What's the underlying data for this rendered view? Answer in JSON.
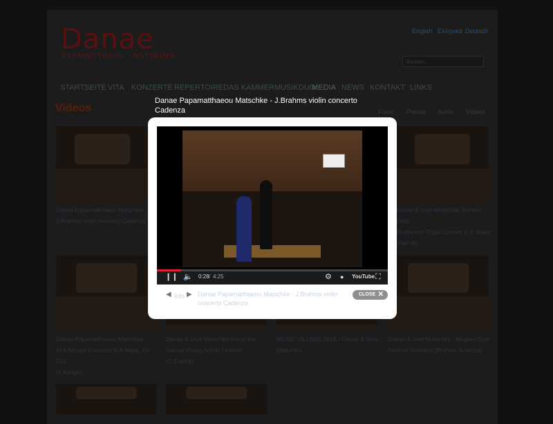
{
  "site": {
    "logo_text": "Danae",
    "logo_subtitle": "PAPAMATTHAOU - MATSCHKE",
    "languages": [
      "English",
      "Ελληνικά",
      "Deutsch"
    ],
    "search_placeholder": "Suchen...",
    "nav": [
      "STARTSEITE",
      "VITA",
      "KONZERTE",
      "REPERTOIRE",
      "DAS KAMMERMUSIKDUO",
      "MEDIA",
      "NEWS",
      "KONTAKT",
      "LINKS"
    ],
    "active_nav": "MEDIA",
    "page_heading": "Videos",
    "subtabs": [
      "Fotos",
      "Presse",
      "Audio",
      "Videos"
    ]
  },
  "videos": [
    {
      "caption_lines": [
        "Danae Papamatthaeou Matschke -",
        "J.Brahms violin concerto Cadenza"
      ]
    },
    {
      "caption_lines": [
        "Danae & Uwe Matschke, Kerstin Feltz -",
        "Beethoven Triple Concert in C Major",
        "(Part III)"
      ]
    },
    {
      "caption_lines": [
        "Danae Papamatthaeou-Matschke -",
        "W.A.Mozart Concerto in A Major, KV 219",
        "(II Adagio)"
      ]
    },
    {
      "caption_lines": [
        "Danae & Uwe Matschke live at the",
        "Samos Young Artists Festival (C.Franck)"
      ]
    },
    {
      "caption_lines": [
        "MUSIC VILLAGE 2010 - Danae & Uwe",
        "Matschke"
      ]
    },
    {
      "caption_lines": [
        "Danae & Uwe Matschke - Megaro Gyzi",
        "Festival Santorini (Brahms Scherzo)"
      ]
    }
  ],
  "modal": {
    "title": "Danae Papamatthaeou Matschke - J.Brahms violin concerto Cadenza",
    "player": {
      "current_time": "0:28",
      "duration": "4:25",
      "progress_fraction": 0.106,
      "youtube_label": "YouTube"
    },
    "footer_info_label": "Info",
    "footer_caption": "Danae Papamatthaeou Matschke - J.Brahms violin concerto Cadenza",
    "close_label": "CLOSE"
  },
  "colors": {
    "logo": "#5a1010",
    "heading": "#5b1d07",
    "progress": "#dd2233"
  }
}
